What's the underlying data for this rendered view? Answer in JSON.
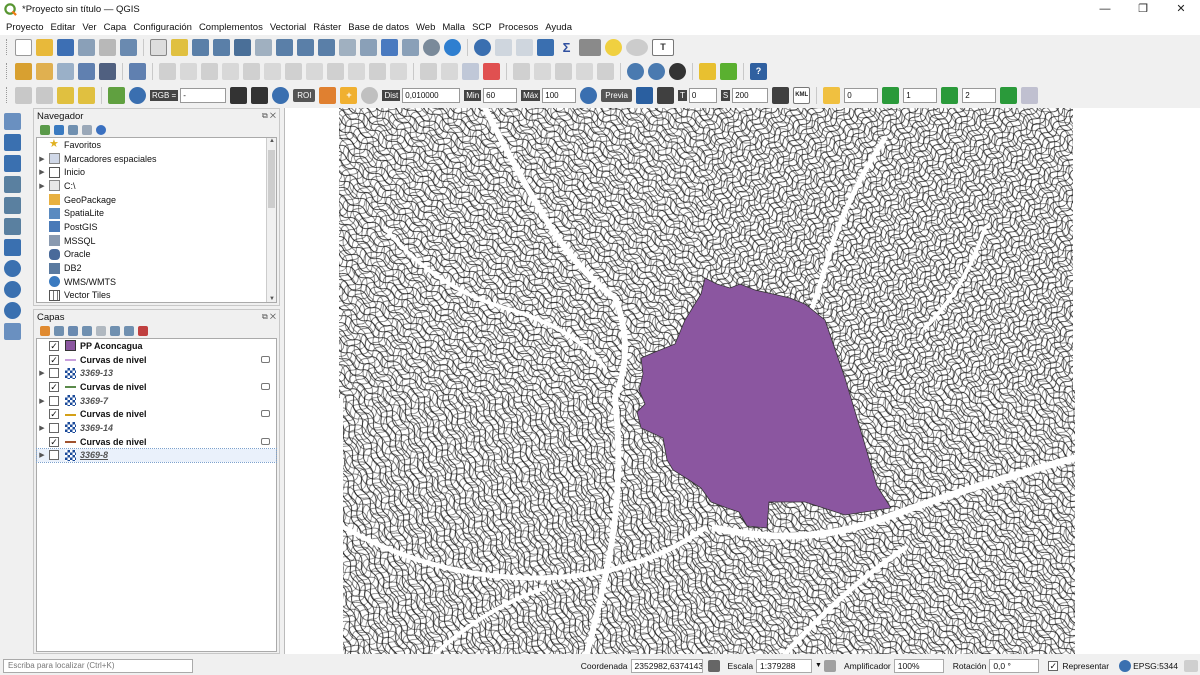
{
  "window": {
    "title": "*Proyecto sin título — QGIS",
    "minimize": "—",
    "maximize": "❐",
    "close": "✕"
  },
  "menu": [
    "Proyecto",
    "Editar",
    "Ver",
    "Capa",
    "Configuración",
    "Complementos",
    "Vectorial",
    "Ráster",
    "Base de datos",
    "Web",
    "Malla",
    "SCP",
    "Procesos",
    "Ayuda"
  ],
  "scp_toolbar": {
    "rgb_label": "RGB =",
    "rgb_value": "-",
    "roi_label": "ROI",
    "dist_label": "Dist",
    "dist_value": "0,010000",
    "min_label": "Min",
    "min_value": "60",
    "max_label": "Máx",
    "max_value": "100",
    "preview_label": "Previa",
    "t_label": "T",
    "t_value": "0",
    "s_label": "S",
    "s_value": "200",
    "kml_label": "KML",
    "band_a": "0",
    "band_b": "1",
    "band_c": "2"
  },
  "browser": {
    "title": "Navegador",
    "items": [
      "Favoritos",
      "Marcadores espaciales",
      "Inicio",
      "C:\\",
      "GeoPackage",
      "SpatiaLite",
      "PostGIS",
      "MSSQL",
      "Oracle",
      "DB2",
      "WMS/WMTS",
      "Vector Tiles"
    ]
  },
  "layers": {
    "title": "Capas",
    "items": [
      {
        "name": "PP Aconcagua",
        "checked": true,
        "color": "#8b56a0"
      },
      {
        "name": "Curvas de nivel",
        "checked": true,
        "color": "#c9a0dc"
      },
      {
        "name": "3369-13",
        "checked": false
      },
      {
        "name": "Curvas de nivel",
        "checked": true,
        "color": "#5a8a4a"
      },
      {
        "name": "3369-7",
        "checked": false
      },
      {
        "name": "Curvas de nivel",
        "checked": true,
        "color": "#d4a017"
      },
      {
        "name": "3369-14",
        "checked": false
      },
      {
        "name": "Curvas de nivel",
        "checked": true,
        "color": "#a0522d"
      },
      {
        "name": "3369-8",
        "checked": false
      }
    ]
  },
  "map": {
    "colors": {
      "green": "#5f9160",
      "brown": "#9a5a40",
      "pink": "#e58fa4",
      "yellow": "#d0a82c",
      "polygon": "#8b56a0"
    }
  },
  "status": {
    "locator_placeholder": "Escriba para localizar (Ctrl+K)",
    "coord_label": "Coordenada",
    "coord_value": "2352982,6374143",
    "scale_label": "Escala",
    "scale_value": "1:379288",
    "magnifier_label": "Amplificador",
    "magnifier_value": "100%",
    "rotation_label": "Rotación",
    "rotation_value": "0,0 °",
    "render_label": "Representar",
    "crs": "EPSG:5344"
  }
}
